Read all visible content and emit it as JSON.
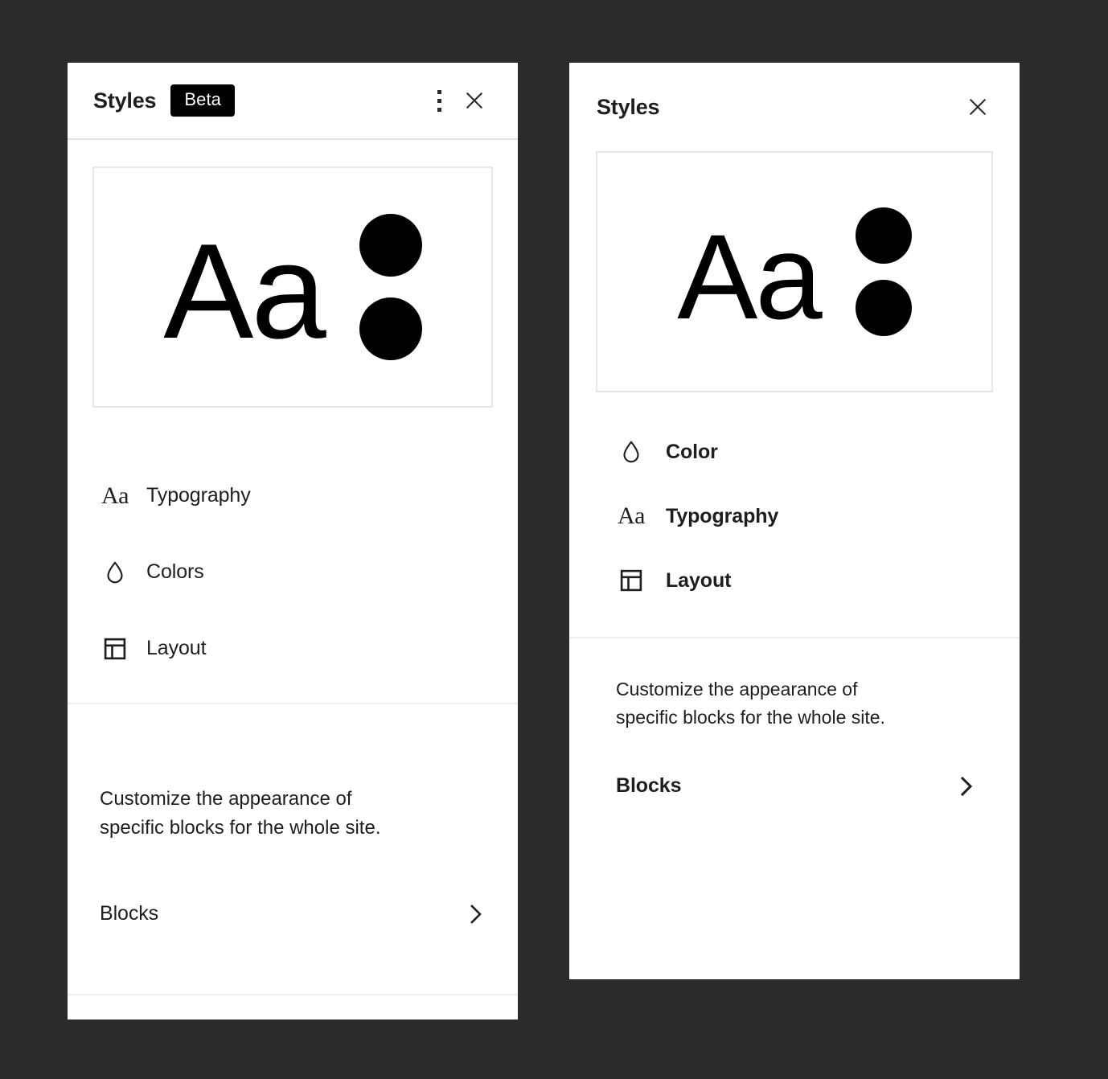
{
  "background_color": "#2b2b2b",
  "panels": [
    {
      "id": "left",
      "header": {
        "title": "Styles",
        "badge": "Beta",
        "menu_icon": "kebab-menu-icon",
        "close_icon": "close-icon"
      },
      "preview": {
        "sample_text": "Aa",
        "swatch_colors": [
          "#000000",
          "#000000"
        ]
      },
      "menu": [
        {
          "label": "Typography",
          "icon": "typography-icon",
          "glyph": "Aa"
        },
        {
          "label": "Colors",
          "icon": "droplet-icon"
        },
        {
          "label": "Layout",
          "icon": "layout-icon"
        }
      ],
      "blocks": {
        "description": "Customize the appearance of\nspecific blocks for the whole site.",
        "link_label": "Blocks",
        "link_icon": "chevron-right-icon"
      }
    },
    {
      "id": "right",
      "header": {
        "title": "Styles",
        "close_icon": "close-icon"
      },
      "preview": {
        "sample_text": "Aa",
        "swatch_colors": [
          "#000000",
          "#000000"
        ]
      },
      "menu": [
        {
          "label": "Color",
          "icon": "droplet-icon"
        },
        {
          "label": "Typography",
          "icon": "typography-icon",
          "glyph": "Aa"
        },
        {
          "label": "Layout",
          "icon": "layout-icon"
        }
      ],
      "blocks": {
        "description": "Customize the appearance of\nspecific blocks for the whole site.",
        "link_label": "Blocks",
        "link_icon": "chevron-right-icon"
      }
    }
  ]
}
